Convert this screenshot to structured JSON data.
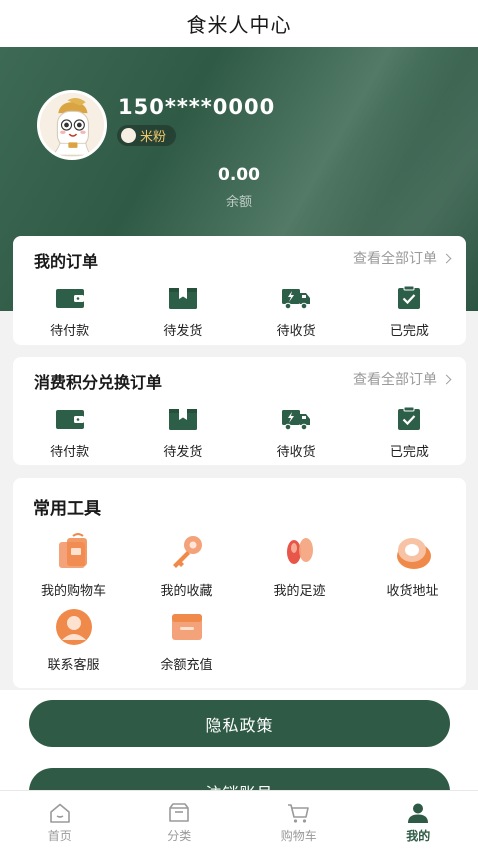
{
  "header": {
    "title": "食米人中心"
  },
  "profile": {
    "phone": "150****0000",
    "badge": "米粉",
    "balance_value": "0.00",
    "balance_label": "余额"
  },
  "orders": {
    "title": "我的订单",
    "view_all": "查看全部订单",
    "items": [
      {
        "label": "待付款",
        "icon": "wallet-icon"
      },
      {
        "label": "待发货",
        "icon": "box-icon"
      },
      {
        "label": "待收货",
        "icon": "truck-icon"
      },
      {
        "label": "已完成",
        "icon": "clipboard-check-icon"
      }
    ]
  },
  "points_orders": {
    "title": "消费积分兑换订单",
    "view_all": "查看全部订单",
    "items": [
      {
        "label": "待付款",
        "icon": "wallet-icon"
      },
      {
        "label": "待发货",
        "icon": "box-icon"
      },
      {
        "label": "待收货",
        "icon": "truck-icon"
      },
      {
        "label": "已完成",
        "icon": "clipboard-check-icon"
      }
    ]
  },
  "tools": {
    "title": "常用工具",
    "items": [
      {
        "label": "我的购物车",
        "icon": "cart-box-icon"
      },
      {
        "label": "我的收藏",
        "icon": "key-icon"
      },
      {
        "label": "我的足迹",
        "icon": "footprint-icon"
      },
      {
        "label": "收货地址",
        "icon": "location-icon"
      },
      {
        "label": "联系客服",
        "icon": "customer-service-icon"
      },
      {
        "label": "余额充值",
        "icon": "recharge-icon"
      }
    ]
  },
  "actions": {
    "privacy": "隐私政策",
    "logout": "注销账号"
  },
  "tabbar": {
    "items": [
      {
        "label": "首页",
        "icon": "home-icon"
      },
      {
        "label": "分类",
        "icon": "category-icon"
      },
      {
        "label": "购物车",
        "icon": "cart-icon"
      },
      {
        "label": "我的",
        "icon": "user-icon"
      }
    ],
    "active_index": 3
  },
  "colors": {
    "brand_green": "#2f5a45",
    "icon_green": "#2d5e48",
    "accent_orange": "#f08a4b",
    "badge_gold": "#f1c56a"
  }
}
